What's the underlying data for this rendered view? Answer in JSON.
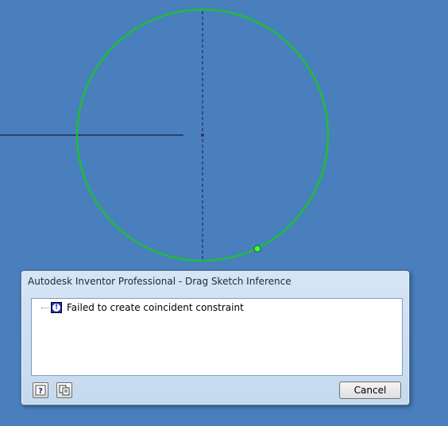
{
  "dialog": {
    "title": "Autodesk Inventor Professional - Drag Sketch Inference",
    "message": "Failed to create coincident constraint",
    "cancel_label": "Cancel",
    "help_icon": "help-question-icon",
    "copy_icon": "copy-icon",
    "info_icon": "info-icon"
  },
  "sketch": {
    "circle_color": "#1ebd3a",
    "background_color": "#4a7fbd",
    "line_color": "#1a1a4a"
  }
}
